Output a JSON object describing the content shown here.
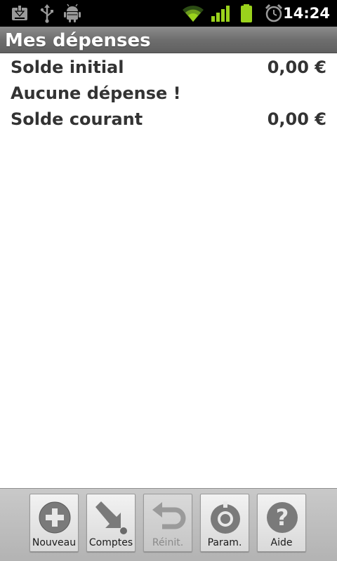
{
  "status_bar": {
    "time": "14:24",
    "icons": [
      "download-icon",
      "usb-icon",
      "android-debug-icon",
      "wifi-icon",
      "signal-icon",
      "battery-icon",
      "alarm-icon"
    ],
    "colors": {
      "signal": "#9ad21c",
      "battery": "#9ad21c"
    }
  },
  "header": {
    "title": "Mes dépenses"
  },
  "summary": {
    "initial_label": "Solde initial",
    "initial_value": "0,00 €",
    "empty_message": "Aucune dépense !",
    "current_label": "Solde courant",
    "current_value": "0,00 €"
  },
  "menu": {
    "new": "Nouveau",
    "accounts": "Comptes",
    "reset": "Réinit.",
    "settings": "Param.",
    "help": "Aide"
  }
}
